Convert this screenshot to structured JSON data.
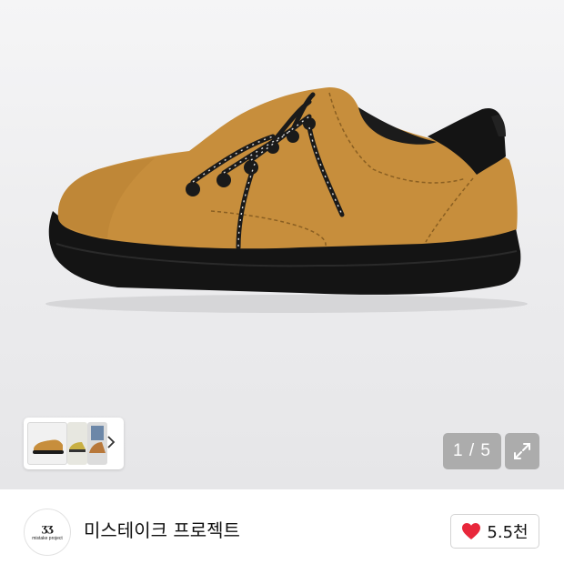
{
  "gallery": {
    "image_alt": "shoe product photo",
    "page_counter": "1 / 5",
    "thumbnails": [
      "thumb-1",
      "thumb-2",
      "thumb-3"
    ],
    "thumb_next_icon": "chevron-right-icon",
    "expand_icon": "expand-icon"
  },
  "shop": {
    "name": "미스테이크 프로젝트",
    "logo_mark": "ʒʒ",
    "logo_text": "mistake project"
  },
  "like": {
    "icon": "heart-icon",
    "color": "#e8273b",
    "count": "5.5천"
  }
}
